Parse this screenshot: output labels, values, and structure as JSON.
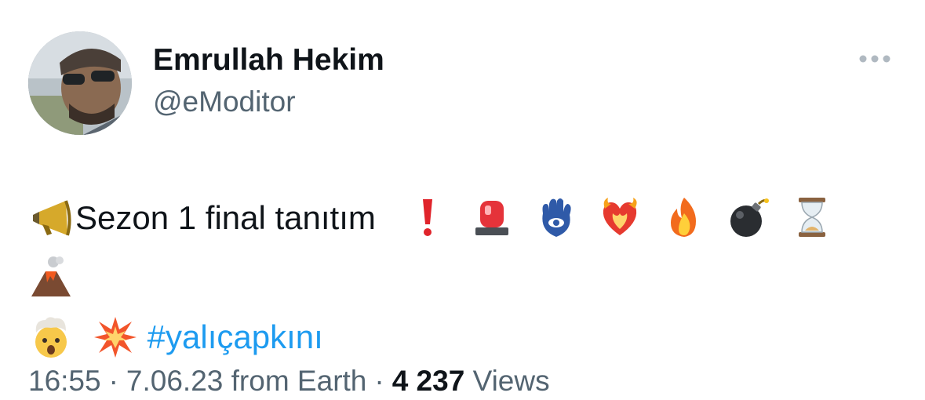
{
  "author": {
    "display_name": "Emrullah Hekim",
    "handle": "@eModitor"
  },
  "more_icon": "more-horizontal-icon",
  "tweet": {
    "text": "Sezon 1 final tanıtım",
    "hashtag": "#yalıçapkını",
    "emojis": [
      "megaphone-emoji",
      "exclamation-emoji",
      "rotating-light-emoji",
      "hamsa-emoji",
      "heart-on-fire-emoji",
      "fire-emoji",
      "bomb-emoji",
      "hourglass-emoji",
      "volcano-emoji",
      "exploding-head-emoji",
      "collision-emoji"
    ]
  },
  "meta": {
    "time": "16:55",
    "date": "7.06.23",
    "source": "from Earth",
    "separator": "·",
    "views_count": "4 237",
    "views_label": "Views"
  },
  "colors": {
    "text": "#0f1419",
    "secondary": "#536471",
    "link": "#1d9bf0"
  }
}
